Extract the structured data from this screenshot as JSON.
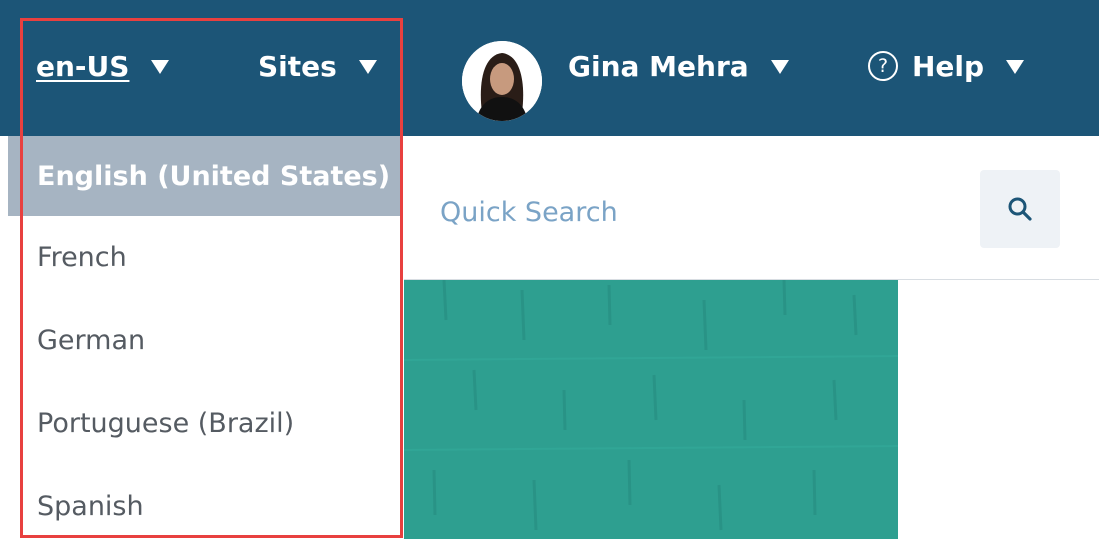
{
  "header": {
    "language": "en-US",
    "sites": "Sites",
    "user_name": "Gina Mehra",
    "help": "Help",
    "help_icon_glyph": "?"
  },
  "language_dropdown": {
    "items": [
      {
        "label": "English (United States)",
        "selected": true
      },
      {
        "label": "French",
        "selected": false
      },
      {
        "label": "German",
        "selected": false
      },
      {
        "label": "Portuguese (Brazil)",
        "selected": false
      },
      {
        "label": "Spanish",
        "selected": false
      }
    ]
  },
  "search": {
    "placeholder": "Quick Search"
  },
  "colors": {
    "header_bg": "#1c5577",
    "selected_item_bg": "#a6b4c2",
    "banner": "#2e9f90",
    "highlight_border": "#e8403f"
  },
  "icons": [
    "caret-down-icon",
    "avatar-photo",
    "help-circle-icon",
    "search-icon"
  ]
}
